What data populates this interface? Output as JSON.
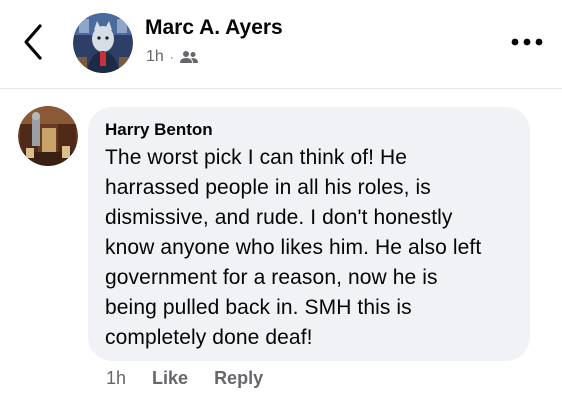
{
  "header": {
    "author_name": "Marc A. Ayers",
    "post_time": "1h",
    "separator": "·",
    "audience_icon": "friends-icon",
    "back_icon": "chevron-left-icon",
    "more_icon": "more-dots-icon"
  },
  "comment": {
    "author_name": "Harry Benton",
    "text_lines": [
      "The worst pick I can think of! He",
      "harrassed people in all his roles, is",
      "dismissive, and rude. I don't honestly",
      "know anyone who likes him. He also left",
      "government for a reason, now he is",
      "being pulled back in. SMH this is",
      "completely done deaf!"
    ],
    "time": "1h",
    "like_label": "Like",
    "reply_label": "Reply"
  },
  "colors": {
    "bubble_background": "#f0f2f5",
    "secondary_text": "#65676b",
    "primary_text": "#050505"
  }
}
